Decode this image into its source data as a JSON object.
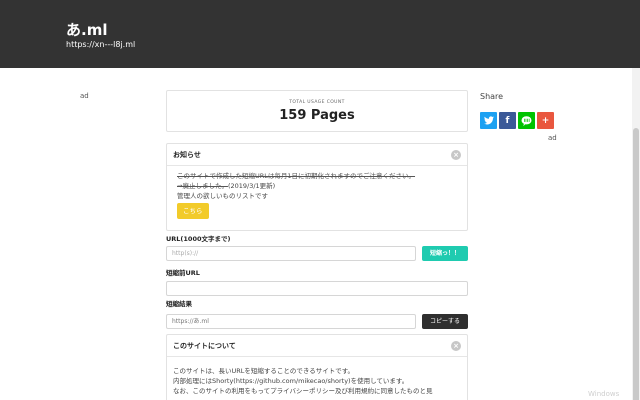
{
  "header": {
    "title": "あ.ml",
    "url": "https://xn---l8j.ml"
  },
  "ads": {
    "left": "ad",
    "right": "ad"
  },
  "share": {
    "title": "Share",
    "buttons": [
      {
        "name": "twitter",
        "icon": "twitter-icon",
        "color": "#1da1f2"
      },
      {
        "name": "facebook",
        "icon": "facebook-icon",
        "color": "#3b5998",
        "glyph": "f"
      },
      {
        "name": "line",
        "icon": "line-icon",
        "color": "#00c300"
      },
      {
        "name": "googleplus",
        "icon": "plus-icon",
        "color": "#e9573f",
        "glyph": "+"
      }
    ]
  },
  "usage": {
    "label": "TOTAL USAGE COUNT",
    "value": "159 Pages"
  },
  "notice": {
    "title": "お知らせ",
    "strike_line1": "このサイトで作成した短縮URLは毎月1日に初期化されますのでご注意ください。",
    "strike_line2": "→廃止しました。",
    "date": "(2019/3/1更新)",
    "line3": "管理人の欲しいものリストです",
    "button": "こちら"
  },
  "form": {
    "url_label": "URL(1000文字まで)",
    "url_placeholder": "http(s)://",
    "shorten_button": "短縮っ！！",
    "before_label": "短縮前URL",
    "result_label": "短縮結果",
    "result_value": "https://あ.ml",
    "copy_button": "コピーする"
  },
  "about": {
    "title": "このサイトについて",
    "line1": "このサイトは、長いURLを短縮することのできるサイトです。",
    "line2": "内部処理にはShorty(https://github.com/mikecao/shorty)を使用しています。",
    "line3": "なお、このサイトの利用をもってプライバシーポリシー及び利用規約に同意したものと見"
  },
  "watermark": "Windows"
}
